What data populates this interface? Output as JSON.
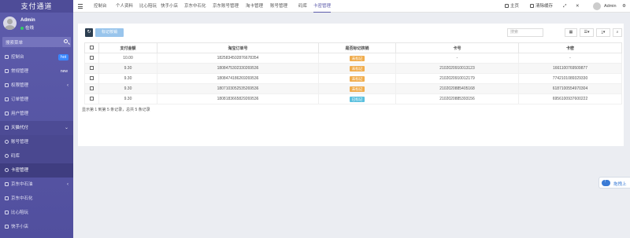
{
  "sidebar": {
    "app_title": "支付通道",
    "user_name": "Admin",
    "user_status": "在线",
    "search_placeholder": "搜索菜单",
    "items": [
      {
        "label": "控制台",
        "badge": "hot",
        "icon": "dashboard-icon"
      },
      {
        "label": "常规管理",
        "badge": "new",
        "icon": "gear-icon"
      },
      {
        "label": "权限管理",
        "caret": "‹",
        "icon": "group-icon"
      },
      {
        "label": "订单管理",
        "icon": "circle-icon"
      },
      {
        "label": "用户管理",
        "icon": "user-icon"
      },
      {
        "label": "天猫代付",
        "caret": "⌄",
        "icon": "list-icon"
      },
      {
        "label": "账号管理",
        "icon": "circle-icon"
      },
      {
        "label": "码库",
        "icon": "circle-icon"
      },
      {
        "label": "卡密管理",
        "icon": "circle-icon"
      },
      {
        "label": "京东中石油",
        "caret": "‹",
        "icon": "list-icon"
      },
      {
        "label": "京东中石化",
        "icon": "list-icon"
      },
      {
        "label": "比心陪玩",
        "icon": "list-icon"
      },
      {
        "label": "快手小店",
        "icon": "list-icon"
      }
    ]
  },
  "topbar": {
    "tabs": [
      "控制台",
      "个人资料",
      "比心陪玩",
      "快手小店",
      "京东中石化",
      "京东账号管理",
      "淘卡管理",
      "账号管理",
      "码库",
      "卡密管理"
    ],
    "home_label": "主页",
    "clear_cache_label": "清除缓存",
    "admin_label": "Admin"
  },
  "toolbar": {
    "refresh_icon": "refresh-icon",
    "mark_button_label": "标记核销",
    "search_placeholder": "搜索"
  },
  "table": {
    "headers": [
      "支付金额",
      "淘宝订单号",
      "是否标记核销",
      "卡号",
      "卡密"
    ],
    "rows": [
      {
        "amount": "10.00",
        "order": "1825834502876678354",
        "status": "未标记",
        "status_type": "warn",
        "card": "-",
        "secret": "-"
      },
      {
        "amount": "9.30",
        "order": "1808475302330269536",
        "status": "未标记",
        "status_type": "warn",
        "card": "2102020910013123",
        "secret": "1661100769509877"
      },
      {
        "amount": "9.30",
        "order": "1808474186269269536",
        "status": "未标记",
        "status_type": "warn",
        "card": "2102020910012179",
        "secret": "7742101089329330"
      },
      {
        "amount": "9.30",
        "order": "1807103052535269536",
        "status": "未标记",
        "status_type": "warn",
        "card": "2102020885405168",
        "secret": "6187100554970304"
      },
      {
        "amount": "9.30",
        "order": "1808183665829269536",
        "status": "已标记",
        "status_type": "info",
        "card": "2102020885393156",
        "secret": "6956100937600222"
      }
    ]
  },
  "pager_text": "显示第 1 到第 5 条记录，总共 5 条记录",
  "float_button_label": "拖拽上",
  "colors": {
    "sidebar": "#5d5cab",
    "warn": "#f0ad4e",
    "info": "#5bc0de",
    "accent": "#3a7bd5"
  }
}
